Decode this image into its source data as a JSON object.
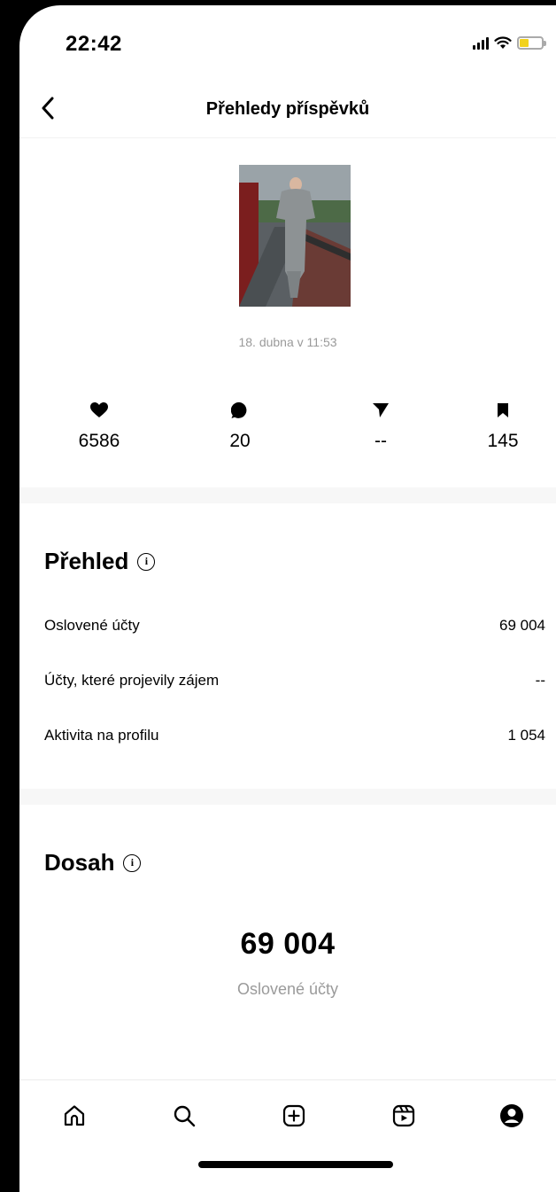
{
  "status_bar": {
    "time": "22:42",
    "signal_icon": "signal-icon",
    "wifi_icon": "wifi-icon",
    "battery_icon": "battery-icon",
    "battery_color": "#f2d21b"
  },
  "header": {
    "back_icon": "chevron-left-icon",
    "title": "Přehledy příspěvků"
  },
  "post": {
    "thumbnail": "post-photo",
    "date": "18. dubna v 11:53"
  },
  "stats": [
    {
      "icon": "heart-icon",
      "value": "6586"
    },
    {
      "icon": "comment-icon",
      "value": "20"
    },
    {
      "icon": "send-icon",
      "value": "--"
    },
    {
      "icon": "bookmark-icon",
      "value": "145"
    }
  ],
  "overview": {
    "title": "Přehled",
    "rows": [
      {
        "label": "Oslovené účty",
        "value": "69 004"
      },
      {
        "label": "Účty, které projevily zájem",
        "value": "--"
      },
      {
        "label": "Aktivita na profilu",
        "value": "1 054"
      }
    ]
  },
  "reach": {
    "title": "Dosah",
    "value": "69 004",
    "label": "Oslovené účty"
  },
  "tab_bar": [
    {
      "icon": "home-icon"
    },
    {
      "icon": "search-icon"
    },
    {
      "icon": "add-post-icon"
    },
    {
      "icon": "reels-icon"
    },
    {
      "icon": "profile-icon"
    }
  ]
}
